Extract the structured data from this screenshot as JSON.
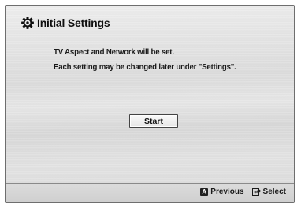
{
  "header": {
    "title": "Initial Settings",
    "icon": "gear-icon"
  },
  "message": {
    "line1": "TV Aspect and Network will be set.",
    "line2": "Each setting may be changed later under \"Settings\"."
  },
  "start_button": {
    "label": "Start"
  },
  "footer": {
    "previous": {
      "key": "A",
      "label": "Previous",
      "icon": "a-key-icon"
    },
    "select": {
      "label": "Select",
      "icon": "enter-key-icon"
    }
  }
}
